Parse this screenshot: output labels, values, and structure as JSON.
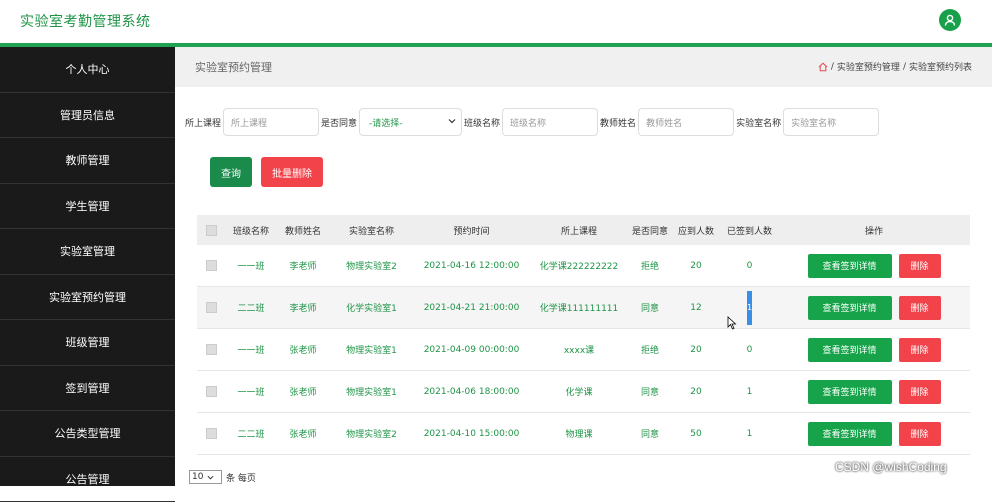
{
  "header": {
    "app_title": "实验室考勤管理系统",
    "avatar_icon": "user-icon",
    "accent": "#21a153"
  },
  "sidebar": {
    "items": [
      {
        "label": "个人中心"
      },
      {
        "label": "管理员信息"
      },
      {
        "label": "教师管理"
      },
      {
        "label": "学生管理"
      },
      {
        "label": "实验室管理"
      },
      {
        "label": "实验室预约管理"
      },
      {
        "label": "班级管理"
      },
      {
        "label": "签到管理"
      },
      {
        "label": "公告类型管理"
      },
      {
        "label": "公告管理"
      }
    ]
  },
  "page": {
    "title": "实验室预约管理",
    "breadcrumb": {
      "home_icon": "home-icon",
      "sep": "/",
      "b1": "实验室预约管理",
      "b2": "实验室预约列表"
    }
  },
  "filters": {
    "course_label": "所上课程",
    "course_placeholder": "所上课程",
    "agree_label": "是否同意",
    "agree_value": "-请选择-",
    "class_label": "班级名称",
    "class_placeholder": "班级名称",
    "teacher_label": "教师姓名",
    "teacher_placeholder": "教师姓名",
    "lab_label": "实验室名称",
    "lab_placeholder": "实验室名称"
  },
  "actions": {
    "query": "查询",
    "batch_delete": "批量删除"
  },
  "table": {
    "headers": [
      "班级名称",
      "教师姓名",
      "实验室名称",
      "预约时间",
      "所上课程",
      "是否同意",
      "应到人数",
      "已签到人数",
      "操作"
    ],
    "rows": [
      {
        "cls": "一一班",
        "teacher": "李老师",
        "lab": "物理实验室2",
        "time": "2021-04-16 12:00:00",
        "course": "化学课222222222",
        "agree": "拒绝",
        "expected": "20",
        "signed": "0"
      },
      {
        "cls": "二二班",
        "teacher": "李老师",
        "lab": "化学实验室1",
        "time": "2021-04-21 21:00:00",
        "course": "化学课111111111",
        "agree": "同意",
        "expected": "12",
        "signed": "1"
      },
      {
        "cls": "一一班",
        "teacher": "张老师",
        "lab": "物理实验室1",
        "time": "2021-04-09 00:00:00",
        "course": "xxxx课",
        "agree": "拒绝",
        "expected": "20",
        "signed": "0"
      },
      {
        "cls": "一一班",
        "teacher": "张老师",
        "lab": "物理实验室1",
        "time": "2021-04-06 18:00:00",
        "course": "化学课",
        "agree": "同意",
        "expected": "20",
        "signed": "1"
      },
      {
        "cls": "二二班",
        "teacher": "张老师",
        "lab": "物理实验室2",
        "time": "2021-04-10 15:00:00",
        "course": "物理课",
        "agree": "同意",
        "expected": "50",
        "signed": "1"
      }
    ],
    "detail_label": "查看签到详情",
    "delete_label": "删除"
  },
  "pager": {
    "size": "10",
    "per_page": "条 每页"
  },
  "watermark": "CSDN @wishCoding"
}
